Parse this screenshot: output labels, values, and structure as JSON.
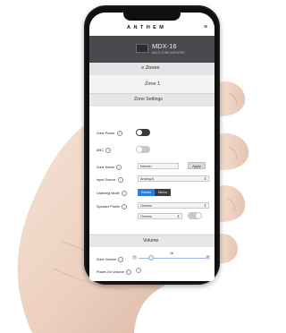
{
  "brand": "ANTHEM",
  "device": {
    "model": "MDX-16",
    "subtitle": "MULTI-ZONE AMPLIFIER"
  },
  "menu": {
    "label": "≡ Zones",
    "hamburger": "≡"
  },
  "zone": {
    "title": "Zone 1"
  },
  "zone_settings": {
    "title": "Zone Settings",
    "zone_power": {
      "label": "Zone Power",
      "value": "on"
    },
    "arc": {
      "label": "ARC",
      "value": "off"
    },
    "zone_name": {
      "label": "Zone Name",
      "value": "Kitchen",
      "button": "Apply"
    },
    "input_source": {
      "label": "Input Source",
      "value": "Analog A"
    },
    "listening_mode": {
      "label": "Listening Mode",
      "options": [
        "Stereo",
        "Mono"
      ],
      "selected": "Stereo"
    },
    "speaker_profile": {
      "label": "Speaker Profile",
      "value": "Generic",
      "second": "Generic"
    }
  },
  "volume": {
    "title": "Volume",
    "zone_volume": {
      "label": "Zone Volume",
      "value": "16",
      "min_icon": "−",
      "max_icon": "+"
    },
    "power_on_volume": {
      "label": "Power-On Volume"
    }
  },
  "colors": {
    "accent": "#2a7de1",
    "header": "#4a4a4e",
    "toggle_on": "#3c3c40"
  }
}
